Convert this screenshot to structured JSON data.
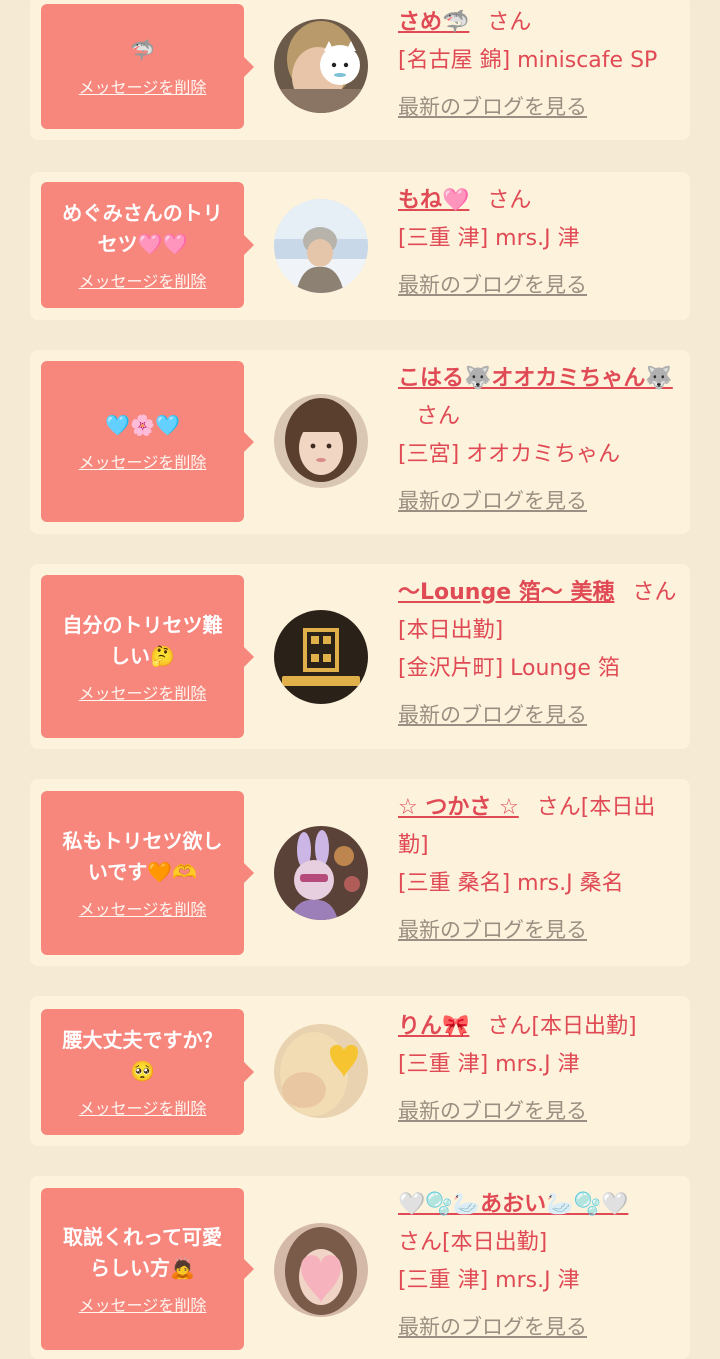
{
  "delete_label": "メッセージを削除",
  "blog_label": "最新のブログを見る",
  "san_label": "さん",
  "colors": {
    "background": "#f5ead3",
    "card": "#fdf3dc",
    "bubble": "#f7877d",
    "name_text": "#e04a55",
    "blog_link": "#9a8f82"
  },
  "cards": [
    {
      "message": "🦈",
      "name": "さめ🦈",
      "san": "さん",
      "status": "",
      "shop": "[名古屋 錦] miniscafe SP",
      "avatar_icon": "woman-with-cat-sticker-photo"
    },
    {
      "message": "めぐみさんのトリセツ🩷🩷",
      "name": "もね🩷",
      "san": "さん",
      "status": "",
      "shop": "[三重 津] mrs.J 津",
      "avatar_icon": "woman-in-snow-photo"
    },
    {
      "message": "🩵🌸🩵",
      "name": "こはる🐺オオカミちゃん🐺",
      "san": "さん",
      "status": "",
      "shop": "[三宮] オオカミちゃん",
      "avatar_icon": "woman-portrait-photo"
    },
    {
      "message": "自分のトリセツ難しい🤔",
      "name": "〜Lounge 箔〜 美穂",
      "san": "さん",
      "status": "[本日出勤]",
      "shop": "[金沢片町] Lounge 箔",
      "avatar_icon": "lounge-logo"
    },
    {
      "message": "私もトリセツ欲しいです🧡🫶",
      "name": "☆ つかさ ☆",
      "san": "さん[本日出勤]",
      "status": "",
      "shop": "[三重 桑名] mrs.J 桑名",
      "avatar_icon": "bunny-ears-photo"
    },
    {
      "message": "腰大丈夫ですか？🥺",
      "name": "りん🎀",
      "san": "さん[本日出勤]",
      "status": "",
      "shop": "[三重 津] mrs.J 津",
      "avatar_icon": "heart-covered-face-photo"
    },
    {
      "message": "取説くれって可愛らしい方🙇",
      "name": "🤍🫧🦢あおい🦢🫧🤍",
      "san": "さん[本日出勤]",
      "status": "",
      "shop": "[三重 津] mrs.J 津",
      "avatar_icon": "heart-covered-face-photo"
    }
  ]
}
